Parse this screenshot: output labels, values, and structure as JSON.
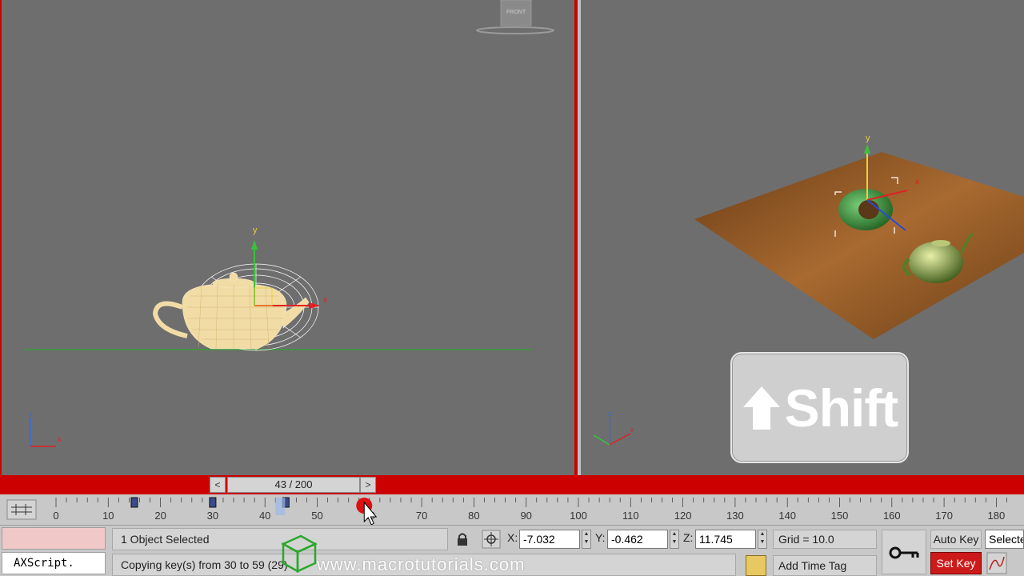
{
  "viewports": {
    "front": {
      "viewcube_label": "FRONT"
    },
    "perspective": {}
  },
  "overlay": {
    "key_label": "Shift"
  },
  "time_slider": {
    "prev": "<",
    "next": ">",
    "frame_label": "43 / 200",
    "current_frame": 43,
    "total_frames": 200
  },
  "trackbar": {
    "ticks": [
      "0",
      "10",
      "20",
      "30",
      "40",
      "50",
      "60",
      "70",
      "80",
      "90",
      "100",
      "110",
      "120",
      "130",
      "140",
      "150",
      "160",
      "170",
      "180"
    ],
    "keys": [
      15,
      30,
      44
    ]
  },
  "status": {
    "listener_text": "AXScript.",
    "selection": "1 Object Selected",
    "prompt": "Copying key(s) from 30 to 59 (29)",
    "x_label": "X:",
    "x_value": "-7.032",
    "y_label": "Y:",
    "y_value": "-0.462",
    "z_label": "Z:",
    "z_value": "11.745",
    "grid": "Grid = 10.0",
    "add_time_tag": "Add Time Tag",
    "auto_key": "Auto Key",
    "set_key": "Set Key",
    "selected_dropdown": "Selected"
  },
  "watermark": "www.macrotutorials.com",
  "colors": {
    "viewport_bg": "#6e6e6e",
    "accent_red": "#cc0000",
    "set_key_red": "#cc1a1a",
    "ground_line": "#3a9a3a",
    "teapot_wire": "#f5dca0"
  },
  "icons": [
    "lock-icon",
    "absolute-mode-icon",
    "key-icon",
    "time-config-icon",
    "curve-editor-icon",
    "cursor-icon",
    "axis-tripod-icon"
  ]
}
